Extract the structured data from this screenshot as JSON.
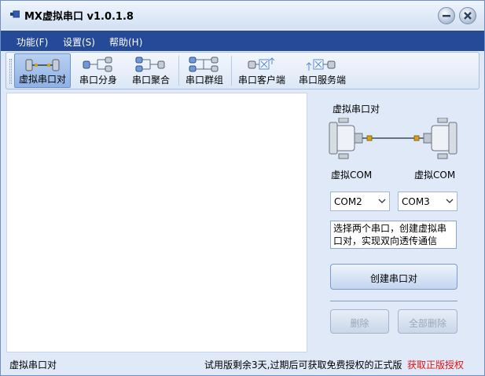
{
  "window": {
    "title": "MX虚拟串口  v1.0.1.8"
  },
  "menu": {
    "items": [
      {
        "label": "功能(F)"
      },
      {
        "label": "设置(S)"
      },
      {
        "label": "帮助(H)"
      }
    ]
  },
  "toolbar": {
    "buttons": [
      {
        "label": "虚拟串口对",
        "icon": "serial-pair-icon",
        "active": true
      },
      {
        "label": "串口分身",
        "icon": "serial-split-icon"
      },
      {
        "label": "串口聚合",
        "icon": "serial-merge-icon"
      },
      {
        "label": "串口群组",
        "icon": "serial-group-icon"
      },
      {
        "label": "串口客户端",
        "icon": "serial-client-icon"
      },
      {
        "label": "串口服务端",
        "icon": "serial-server-icon"
      }
    ]
  },
  "panel": {
    "title": "虚拟串口对",
    "left_label": "虚拟COM",
    "right_label": "虚拟COM",
    "left_port": "COM2",
    "right_port": "COM3",
    "description": "选择两个串口，创建虚拟串口对，实现双向透传通信",
    "create_button": "创建串口对",
    "delete_button": "删除",
    "delete_all_button": "全部删除"
  },
  "status": {
    "mode": "虚拟串口对",
    "trial_text": "试用版剩余3天,过期后可获取免费授权的正式版",
    "license_link": "获取正版授权"
  },
  "colors": {
    "menubar": "#254a97",
    "link": "#e01414"
  }
}
